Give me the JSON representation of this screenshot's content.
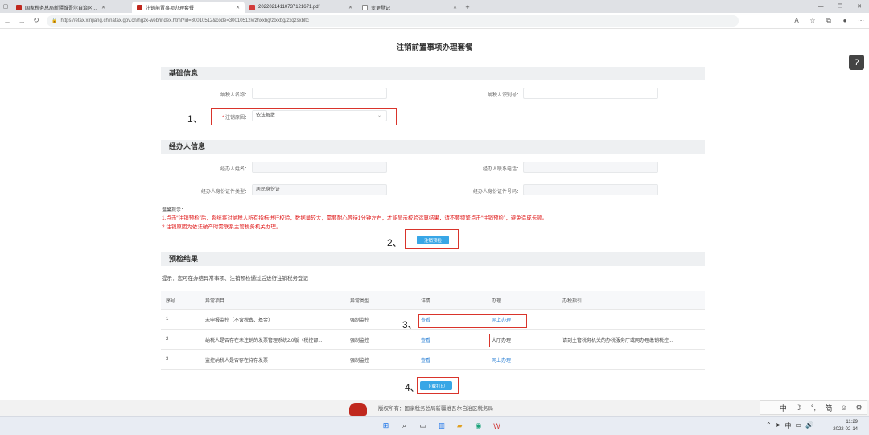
{
  "browser": {
    "tabs": [
      {
        "label": "国家税务总局新疆维吾尔自治区...",
        "active": false,
        "favicon_color": "#c0281e"
      },
      {
        "label": "注销前置事项办理套餐",
        "active": true,
        "favicon_color": "#c0281e"
      },
      {
        "label": "20220214110737121671.pdf",
        "active": false,
        "favicon_color": "#d23b3b"
      },
      {
        "label": "变更登记",
        "active": false,
        "favicon_color": "#888888"
      }
    ],
    "url": "https://etax.xinjiang.chinatax.gov.cn/hgzx-web/index.html?id=30010512&code=30010512#/zhxxbg/ztxxbg/zxqzsxbltc"
  },
  "page": {
    "title": "注销前置事项办理套餐",
    "basic_info": {
      "heading": "基础信息",
      "taxpayer_name_label": "纳税人名称：",
      "taxpayer_id_label": "纳税人识别号：",
      "cancel_reason_label": "注销原因：",
      "cancel_reason_value": "依法解散"
    },
    "agent_info": {
      "heading": "经办人信息",
      "name_label": "经办人姓名：",
      "phone_label": "经办人联系电话：",
      "id_type_label": "经办人身份证件类型：",
      "id_type_value": "居民身份证",
      "id_number_label": "经办人身份证件号码："
    },
    "tips": {
      "title": "温馨提示：",
      "line1": "1.点击“注销预检”后，系统将对纳税人所有指标进行校验，数据量较大，需要耐心等待1分钟左右，才能显示校验运算结果，请不要频繁点击“注销预检”，避免造成卡顿。",
      "line2": "2.注销原因为依法破产时需联系主管税务机关办理。"
    },
    "precheck_button": "注销预检",
    "results": {
      "heading": "预检结果",
      "hint": "提示：您可在办结异常事项、注销预检通过后进行注销税务登记",
      "columns": [
        "序号",
        "异常项目",
        "异常类型",
        "详情",
        "办理",
        "办税指引"
      ],
      "rows": [
        {
          "no": "1",
          "item": "未申报监控（不含税费、基金）",
          "type": "强制监控",
          "detail": "查看",
          "handle": "网上办理",
          "guide": ""
        },
        {
          "no": "2",
          "item": "纳税人是否存在未注销的发票管理系统2.0版（税控部...",
          "type": "强制监控",
          "detail": "查看",
          "handle": "大厅办理",
          "guide": "请到主管税务机关的办税服务厅或网办理缴销税控..."
        },
        {
          "no": "3",
          "item": "监控纳税人是否存在待存发票",
          "type": "强制监控",
          "detail": "查看",
          "handle": "网上办理",
          "guide": ""
        }
      ]
    },
    "print_button": "下载打印",
    "footer_text": "版权所有：国家税务总局新疆维吾尔自治区税务局"
  },
  "annotations": [
    "1、",
    "2、",
    "3、",
    "4、"
  ],
  "ime": {
    "items": [
      "中",
      "简"
    ]
  },
  "taskbar": {
    "tray_lang": "中",
    "time": "11:29",
    "date": "2022-02-14"
  }
}
